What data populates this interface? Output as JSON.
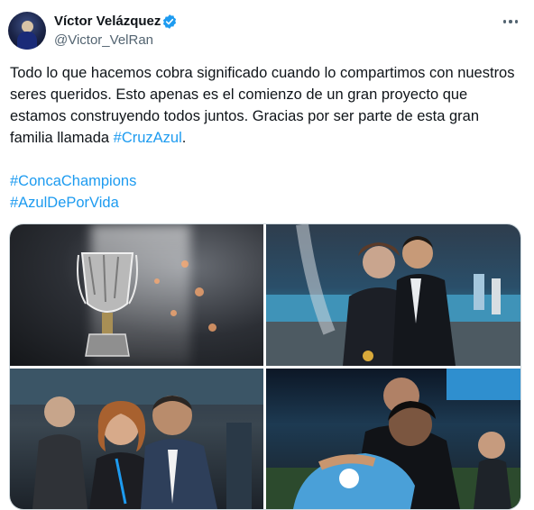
{
  "author": {
    "name": "Víctor Velázquez",
    "handle": "@Victor_VelRan",
    "verified": true,
    "verified_color": "#1d9bf0"
  },
  "menu": {
    "icon": "more-horizontal-icon"
  },
  "tweet": {
    "text_before_tag": "Todo lo que hacemos cobra significado cuando lo compartimos con nuestros seres queridos. Esto apenas es el comienzo de un gran proyecto que estamos construyendo todos juntos. Gracias por ser parte de esta gran familia llamada ",
    "inline_hashtag": "#CruzAzul",
    "text_after_tag": ".",
    "hashtags": [
      "#ConcaChampions",
      "#AzulDePorVida"
    ]
  },
  "colors": {
    "link": "#1d9bf0",
    "text": "#0f1419",
    "secondary": "#536471",
    "border": "#cfd9de"
  },
  "media": {
    "photos": [
      {
        "subject": "trophy"
      },
      {
        "subject": "two-people-with-medal"
      },
      {
        "subject": "couple-in-stadium"
      },
      {
        "subject": "embrace-on-field"
      }
    ]
  }
}
